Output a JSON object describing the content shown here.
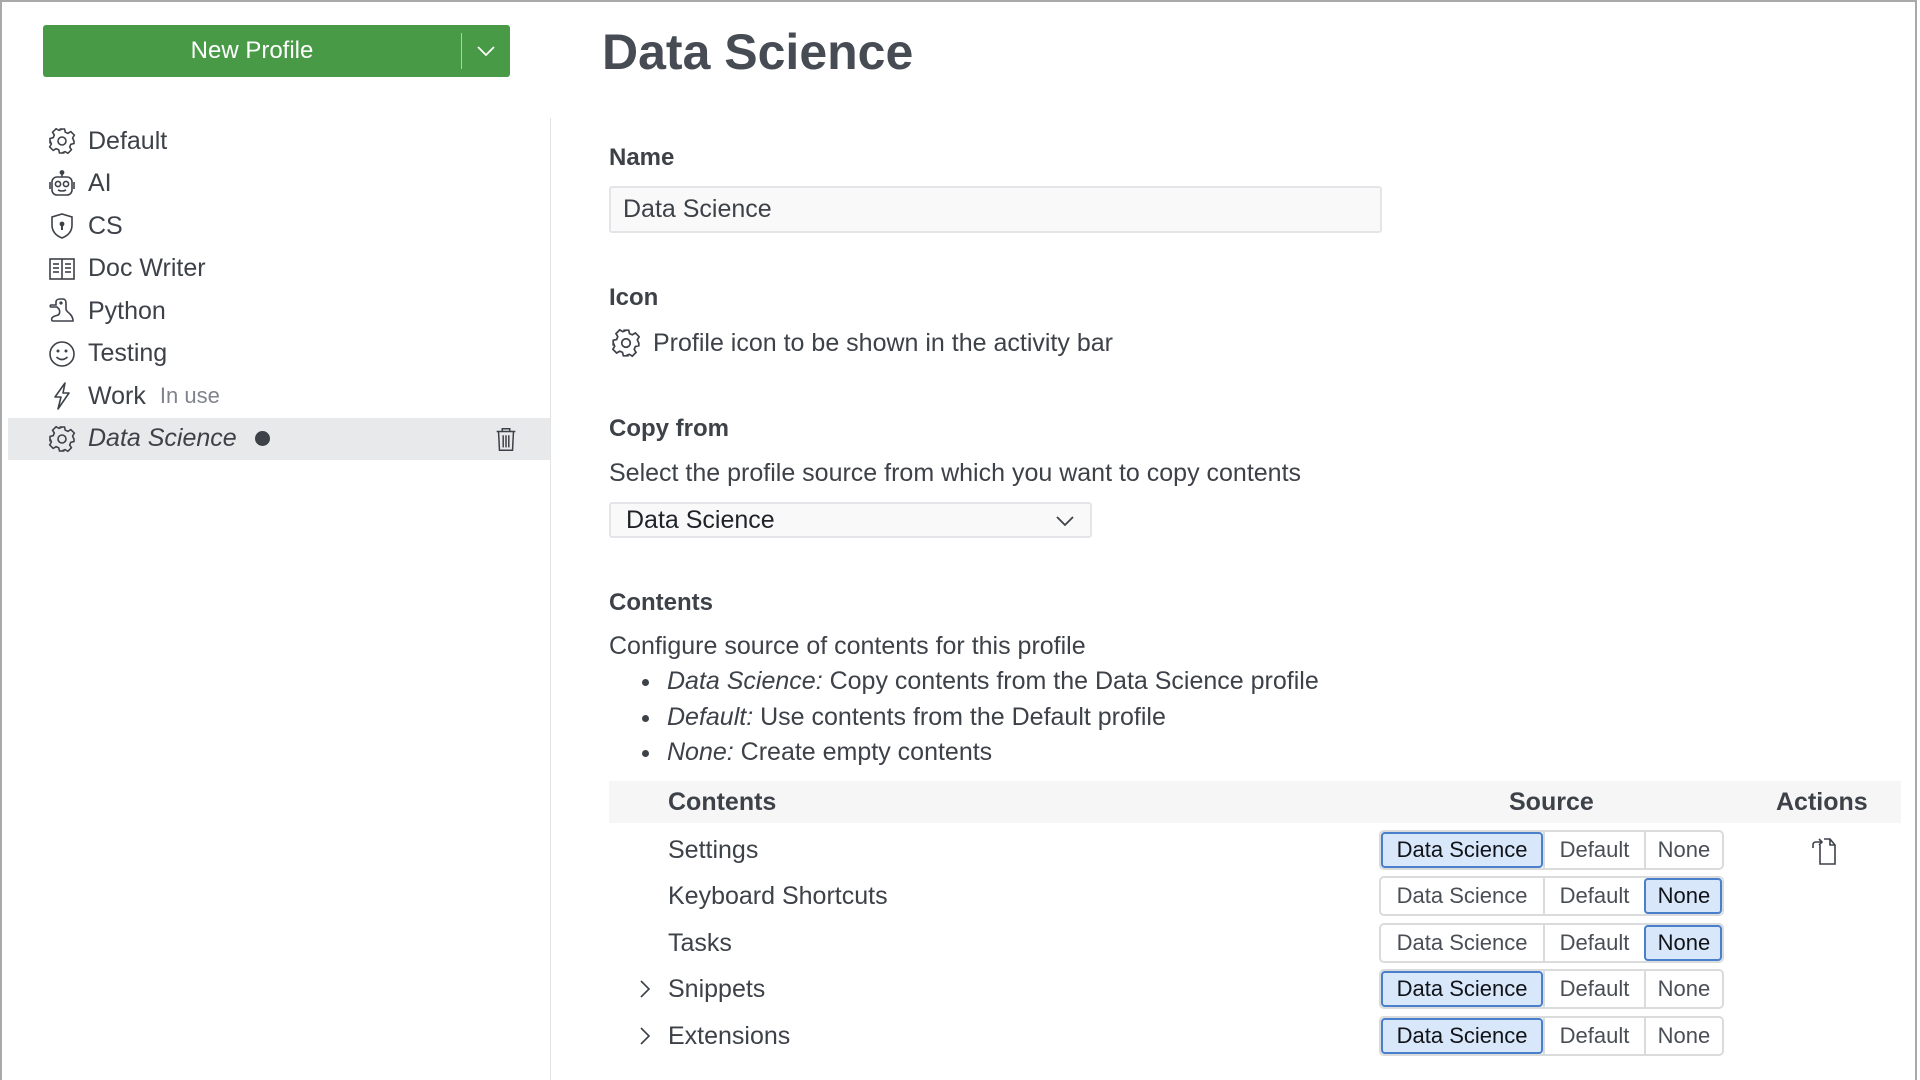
{
  "header": {
    "new_profile_label": "New Profile",
    "title": "Data Science"
  },
  "sidebar": {
    "items": [
      {
        "label": "Default",
        "icon": "gear-icon"
      },
      {
        "label": "AI",
        "icon": "robot-icon"
      },
      {
        "label": "CS",
        "icon": "shield-lock-icon"
      },
      {
        "label": "Doc Writer",
        "icon": "book-icon"
      },
      {
        "label": "Python",
        "icon": "python-icon"
      },
      {
        "label": "Testing",
        "icon": "smiley-icon"
      },
      {
        "label": "Work",
        "icon": "lightning-icon",
        "badge": "In use"
      },
      {
        "label": "Data Science",
        "icon": "gear-icon",
        "selected": true,
        "modified": true
      }
    ]
  },
  "form": {
    "name_label": "Name",
    "name_value": "Data Science",
    "icon_label": "Icon",
    "icon_description": "Profile icon to be shown in the activity bar",
    "copy_from_label": "Copy from",
    "copy_from_description": "Select the profile source from which you want to copy contents",
    "copy_from_selected": "Data Science",
    "contents_label": "Contents",
    "contents_description": "Configure source of contents for this profile",
    "bullets": [
      {
        "term": "Data Science:",
        "text": " Copy contents from the Data Science profile"
      },
      {
        "term": "Default:",
        "text": " Use contents from the Default profile"
      },
      {
        "term": "None:",
        "text": " Create empty contents"
      }
    ]
  },
  "table": {
    "headers": {
      "contents": "Contents",
      "source": "Source",
      "actions": "Actions"
    },
    "options": [
      "Data Science",
      "Default",
      "None"
    ],
    "rows": [
      {
        "name": "Settings",
        "expandable": false,
        "selected": "Data Science",
        "action": "copy-file-icon"
      },
      {
        "name": "Keyboard Shortcuts",
        "expandable": false,
        "selected": "None"
      },
      {
        "name": "Tasks",
        "expandable": false,
        "selected": "None"
      },
      {
        "name": "Snippets",
        "expandable": true,
        "selected": "Data Science"
      },
      {
        "name": "Extensions",
        "expandable": true,
        "selected": "Data Science"
      }
    ]
  },
  "colors": {
    "primary_button": "#489a47",
    "selected_segment_bg": "#d9e7fb",
    "selected_segment_border": "#4a7fcb",
    "selected_sidebar_bg": "#e8e9eb"
  }
}
